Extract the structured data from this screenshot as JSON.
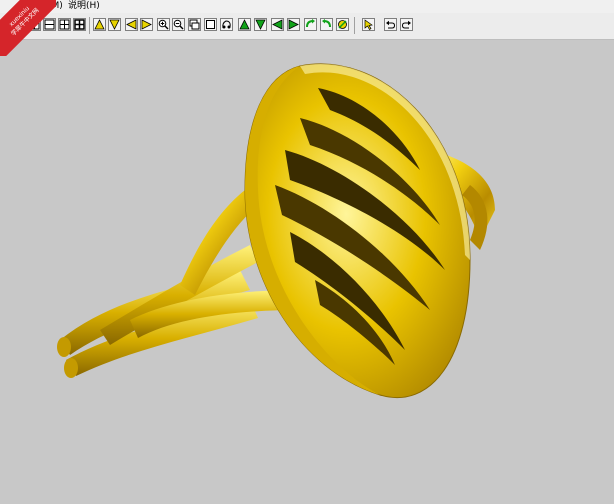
{
  "menu": {
    "items": [
      {
        "label": "(M)"
      },
      {
        "label": "说明(H)"
      }
    ]
  },
  "watermark": {
    "line1": "xuexiniu",
    "line2": "学犀牛中文网"
  },
  "toolbar": {
    "buttons": [
      {
        "icon": "single-view-icon"
      },
      {
        "icon": "split-vertical-icon"
      },
      {
        "icon": "split-horizontal-icon"
      },
      {
        "icon": "four-view-icon"
      },
      {
        "icon": "four-view-bold-icon"
      },
      {
        "icon": "rotate-up-icon"
      },
      {
        "icon": "rotate-down-icon"
      },
      {
        "icon": "rotate-left-icon"
      },
      {
        "icon": "rotate-right-icon"
      },
      {
        "icon": "zoom-in-icon"
      },
      {
        "icon": "zoom-out-icon"
      },
      {
        "icon": "zoom-window-icon"
      },
      {
        "icon": "zoom-extents-icon"
      },
      {
        "icon": "pan-icon"
      },
      {
        "icon": "move-up-icon"
      },
      {
        "icon": "move-down-icon"
      },
      {
        "icon": "move-left-icon"
      },
      {
        "icon": "move-right-icon"
      },
      {
        "icon": "rotate-cw-icon"
      },
      {
        "icon": "rotate-ccw-icon"
      },
      {
        "icon": "render-settings-icon"
      },
      {
        "icon": "select-pointer-icon"
      },
      {
        "icon": "undo-view-icon"
      },
      {
        "icon": "redo-view-icon"
      }
    ]
  },
  "colors": {
    "viewport": "#c8c8c8",
    "gold": "#e6c200",
    "arrow_green": "#11a31a",
    "arrow_yellow": "#e8d400",
    "badge_red": "#d5252a"
  }
}
